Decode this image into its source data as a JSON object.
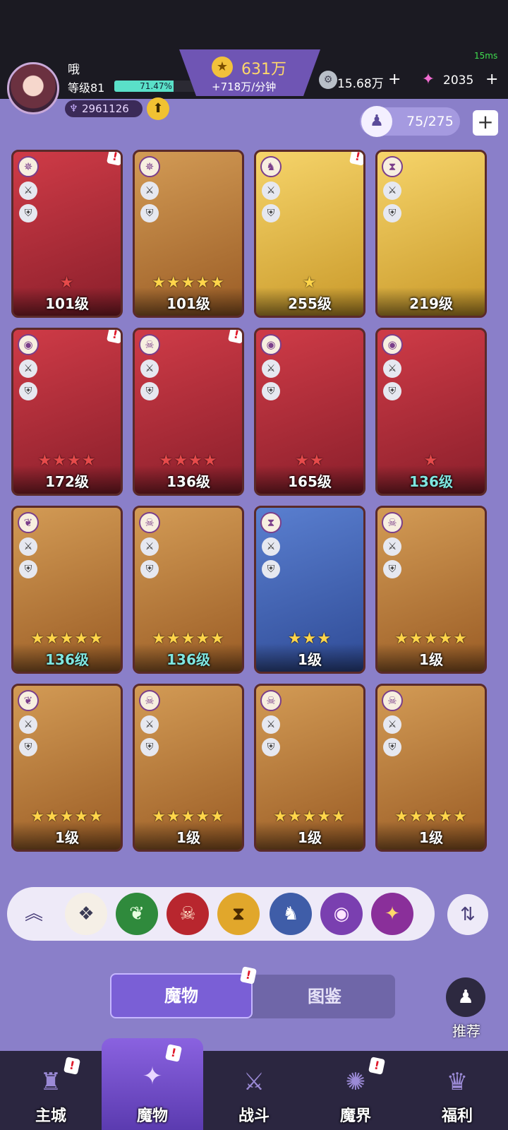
{
  "header": {
    "ping": "15ms",
    "username": "哦",
    "level_label": "等级81",
    "exp_percent": "71.47%",
    "exp_fraction": 0.7147,
    "power": "2961126",
    "gold": "631万",
    "gold_rate": "+718万/分钟",
    "currency1": "15.68万",
    "currency2": "2035",
    "plus": "+"
  },
  "capacity": {
    "text": "75/275",
    "add": "+"
  },
  "cards": [
    {
      "level": "101级",
      "stars": "★",
      "star_color": "#e64a4a",
      "bg": "bg-red",
      "alert": true,
      "level_teal": false
    },
    {
      "level": "101级",
      "stars": "★★★★★",
      "star_color": "#ffd54a",
      "bg": "bg-gold",
      "alert": false,
      "level_teal": false
    },
    {
      "level": "255级",
      "stars": "★",
      "star_color": "#ffd54a",
      "bg": "bg-yellow",
      "alert": true,
      "level_teal": false
    },
    {
      "level": "219级",
      "stars": "",
      "star_color": "#ffd54a",
      "bg": "bg-yellow",
      "alert": false,
      "level_teal": false
    },
    {
      "level": "172级",
      "stars": "★★★★",
      "star_color": "#e64a4a",
      "bg": "bg-red",
      "alert": true,
      "level_teal": false
    },
    {
      "level": "136级",
      "stars": "★★★★",
      "star_color": "#e64a4a",
      "bg": "bg-red",
      "alert": true,
      "level_teal": false
    },
    {
      "level": "165级",
      "stars": "★★",
      "star_color": "#e64a4a",
      "bg": "bg-red",
      "alert": false,
      "level_teal": false
    },
    {
      "level": "136级",
      "stars": "★",
      "star_color": "#e64a4a",
      "bg": "bg-red",
      "alert": false,
      "level_teal": true
    },
    {
      "level": "136级",
      "stars": "★★★★★",
      "star_color": "#ffd54a",
      "bg": "bg-gold",
      "alert": false,
      "level_teal": true
    },
    {
      "level": "136级",
      "stars": "★★★★★",
      "star_color": "#ffd54a",
      "bg": "bg-gold",
      "alert": false,
      "level_teal": true
    },
    {
      "level": "1级",
      "stars": "★★★",
      "star_color": "#ffd54a",
      "bg": "bg-blue",
      "alert": false,
      "level_teal": false
    },
    {
      "level": "1级",
      "stars": "★★★★★",
      "star_color": "#ffd54a",
      "bg": "bg-gold",
      "alert": false,
      "level_teal": false
    },
    {
      "level": "1级",
      "stars": "★★★★★",
      "star_color": "#ffd54a",
      "bg": "bg-gold",
      "alert": false,
      "level_teal": false
    },
    {
      "level": "1级",
      "stars": "★★★★★",
      "star_color": "#ffd54a",
      "bg": "bg-gold",
      "alert": false,
      "level_teal": false
    },
    {
      "level": "1级",
      "stars": "★★★★★",
      "star_color": "#ffd54a",
      "bg": "bg-gold",
      "alert": false,
      "level_teal": false
    },
    {
      "level": "1级",
      "stars": "★★★★★",
      "star_color": "#ffd54a",
      "bg": "bg-gold",
      "alert": false,
      "level_teal": false
    }
  ],
  "filters": [
    {
      "name": "collapse-button",
      "glyph": "︽",
      "bg": "#eeeaf8",
      "color": "#4a3f7a"
    },
    {
      "name": "all-filter",
      "glyph": "❖",
      "bg": "#f5efe6",
      "color": "#3a3a55"
    },
    {
      "name": "nature-filter",
      "glyph": "❦",
      "bg": "#2f8a3c",
      "color": "#e8ffe0"
    },
    {
      "name": "demon-filter",
      "glyph": "☠",
      "bg": "#b8262e",
      "color": "#ffe1c8"
    },
    {
      "name": "time-filter",
      "glyph": "⧗",
      "bg": "#e1a72b",
      "color": "#4a2a00"
    },
    {
      "name": "beast-filter",
      "glyph": "♞",
      "bg": "#3f5da8",
      "color": "#ffffff"
    },
    {
      "name": "eye-filter",
      "glyph": "◉",
      "bg": "#7a3fb0",
      "color": "#ffe6ff"
    },
    {
      "name": "star-filter",
      "glyph": "✦",
      "bg": "#8a2f9a",
      "color": "#ffd86a"
    }
  ],
  "sort_glyph": "⇅",
  "tabs": {
    "monsters": "魔物",
    "codex": "图鉴"
  },
  "recommend": "推荐",
  "nav": [
    {
      "name": "main-city",
      "label": "主城",
      "glyph": "♜",
      "alert": true,
      "active": false,
      "color": "#9b8ad6"
    },
    {
      "name": "monsters",
      "label": "魔物",
      "glyph": "✦",
      "alert": true,
      "active": true,
      "color": "#e9d6ff"
    },
    {
      "name": "battle",
      "label": "战斗",
      "glyph": "⚔",
      "alert": false,
      "active": false,
      "color": "#9b8ad6"
    },
    {
      "name": "demon-realm",
      "label": "魔界",
      "glyph": "✺",
      "alert": true,
      "active": false,
      "color": "#9b8ad6"
    },
    {
      "name": "welfare",
      "label": "福利",
      "glyph": "♛",
      "alert": false,
      "active": false,
      "color": "#9b8ad6"
    }
  ]
}
